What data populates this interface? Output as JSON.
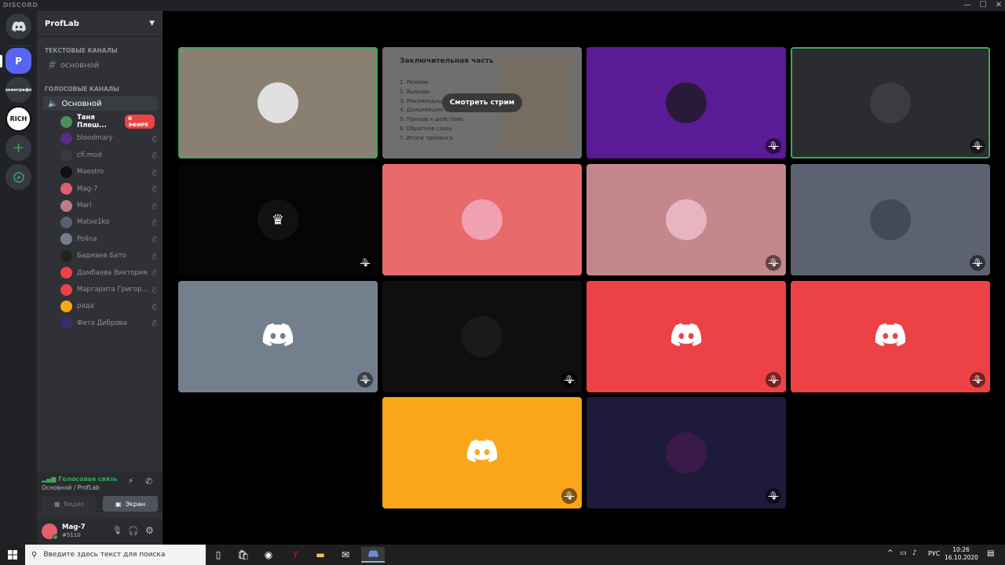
{
  "window": {
    "app_name": "DISCORD",
    "minimize": "—",
    "maximize": "☐",
    "close": "✕"
  },
  "guilds": {
    "server_p": "P",
    "server_b": "рнанграфи",
    "server_rich": "RICH",
    "add": "+",
    "explore": "🧭"
  },
  "server": {
    "name": "ProfLab"
  },
  "categories": {
    "text": "ТЕКСТОВЫЕ КАНАЛЫ",
    "voice": "ГОЛОСОВЫЕ КАНАЛЫ"
  },
  "text_channels": [
    {
      "name": "основной"
    }
  ],
  "voice_channels": [
    {
      "name": "Основной"
    }
  ],
  "voice_users": [
    {
      "name": "Таня Плеш...",
      "badge": "В ЭФИРЕ",
      "color": "#4e8f5a"
    },
    {
      "name": "bloodmary",
      "color": "#5b2a86"
    },
    {
      "name": "cfi.mod",
      "color": "#3a3a3a"
    },
    {
      "name": "Maestro",
      "color": "#111111"
    },
    {
      "name": "Mag-7",
      "color": "#e06070"
    },
    {
      "name": "Marl",
      "color": "#c07a85"
    },
    {
      "name": "Matve1ko",
      "color": "#5a5f6e"
    },
    {
      "name": "Polina",
      "color": "#747f8d"
    },
    {
      "name": "Бадмаев Бато",
      "color": "#222222"
    },
    {
      "name": "Дамбаева Виктория",
      "color": "#ed4245"
    },
    {
      "name": "Маргарита Григор...",
      "color": "#ed4245"
    },
    {
      "name": "рада",
      "color": "#faa61a"
    },
    {
      "name": "Фета Диброва",
      "color": "#3b2b6e"
    }
  ],
  "voice_status": {
    "title": "Голосовая связь подк",
    "subtitle": "Основной / ProfLab",
    "video_btn": "Видео",
    "screen_btn": "Экран"
  },
  "current_user": {
    "name": "Mag-7",
    "tag": "#5110"
  },
  "stream_tile": {
    "slide_title": "Заключительная часть",
    "slide_items": [
      "Резюме",
      "Выводы",
      "Рекомендации",
      "Дальнейшие шаги",
      "Призыв к действию",
      "Обратная связь",
      "Итоги тренинга"
    ],
    "watch_label": "Смотреть стрим"
  },
  "tiles": [
    {
      "bg": "#8a8072",
      "ava": "#e0e0e0",
      "type": "photo",
      "muted": false,
      "speaking": true
    },
    {
      "bg": "stream",
      "muted": false,
      "speaking": false
    },
    {
      "bg": "#5b1a96",
      "ava": "#2a1a3a",
      "type": "photo",
      "muted": true,
      "speaking": false
    },
    {
      "bg": "#2a2c2f",
      "ava": "#3a3c40",
      "type": "photo",
      "muted": true,
      "speaking": true
    },
    {
      "bg": "#050505",
      "ava": "#111111",
      "type": "maestro",
      "muted": true,
      "speaking": false
    },
    {
      "bg": "#e86a6a",
      "ava": "#f0a0b0",
      "type": "photo",
      "muted": false,
      "speaking": false
    },
    {
      "bg": "#c4878c",
      "ava": "#e7b5c0",
      "type": "photo",
      "muted": true,
      "speaking": false
    },
    {
      "bg": "#5c6272",
      "ava": "#444a55",
      "type": "photo",
      "muted": true,
      "speaking": false
    },
    {
      "bg": "#747f8d",
      "ava": "none",
      "type": "discord",
      "muted": true,
      "speaking": false
    },
    {
      "bg": "#0f0f0f",
      "ava": "#1a1a1a",
      "type": "photo",
      "muted": true,
      "speaking": false
    },
    {
      "bg": "#ed4245",
      "ava": "none",
      "type": "discord",
      "muted": true,
      "speaking": false
    },
    {
      "bg": "#ed4245",
      "ava": "none",
      "type": "discord",
      "muted": true,
      "speaking": false
    },
    {
      "bg": "#faa61a",
      "ava": "none",
      "type": "discord",
      "muted": true,
      "speaking": false
    },
    {
      "bg": "#1e1b3a",
      "ava": "#3a1a4a",
      "type": "photo",
      "muted": true,
      "speaking": false
    }
  ],
  "taskbar": {
    "search_placeholder": "Введите здесь текст для поиска",
    "lang": "РУС",
    "time": "10:26",
    "date": "16.10.2020"
  }
}
